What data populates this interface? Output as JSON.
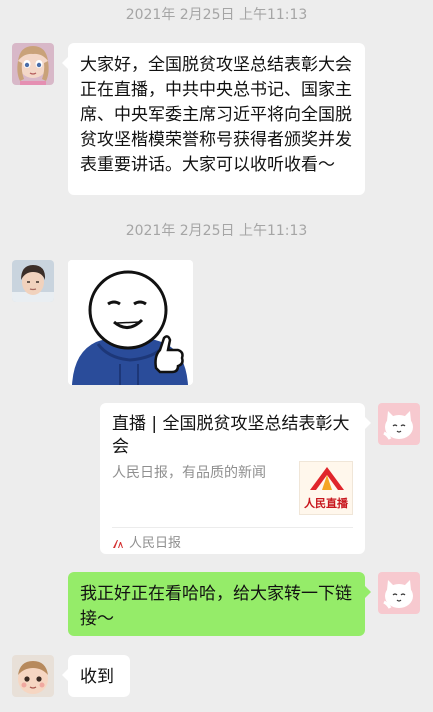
{
  "chat": {
    "timestamp_1": "2021年 2月25日 上午11:13",
    "timestamp_2": "2021年 2月25日 上午11:13",
    "message_1": "大家好，全国脱贫攻坚总结表彰大会正在直播，中共中央总书记、国家主席、中央军委主席习近平将向全国脱贫攻坚楷模荣誉称号获得者颁奖并发表重要讲话。大家可以收听收看～",
    "link_card": {
      "title": "直播 | 全国脱贫攻坚总结表彰大会",
      "description": "人民日报，有品质的新闻",
      "thumbnail_caption": "人民直播",
      "source_name": "人民日报"
    },
    "message_2": "我正好正在看哈哈，给大家转一下链接～",
    "message_3": "收到"
  },
  "icons": {
    "avatar_1": "anime-girl-avatar",
    "avatar_2": "young-man-avatar",
    "avatar_self": "cartoon-cat-avatar",
    "avatar_3": "baby-avatar",
    "sticker": "thumbs-up-cartoon-sticker",
    "thumbnail": "renmin-live-logo",
    "source_logo": "people-daily-logo"
  },
  "colors": {
    "background": "#ededed",
    "incoming_bubble": "#ffffff",
    "outgoing_bubble": "#95ec69",
    "timestamp": "#a5a5a5",
    "brand_red": "#c8161d"
  }
}
